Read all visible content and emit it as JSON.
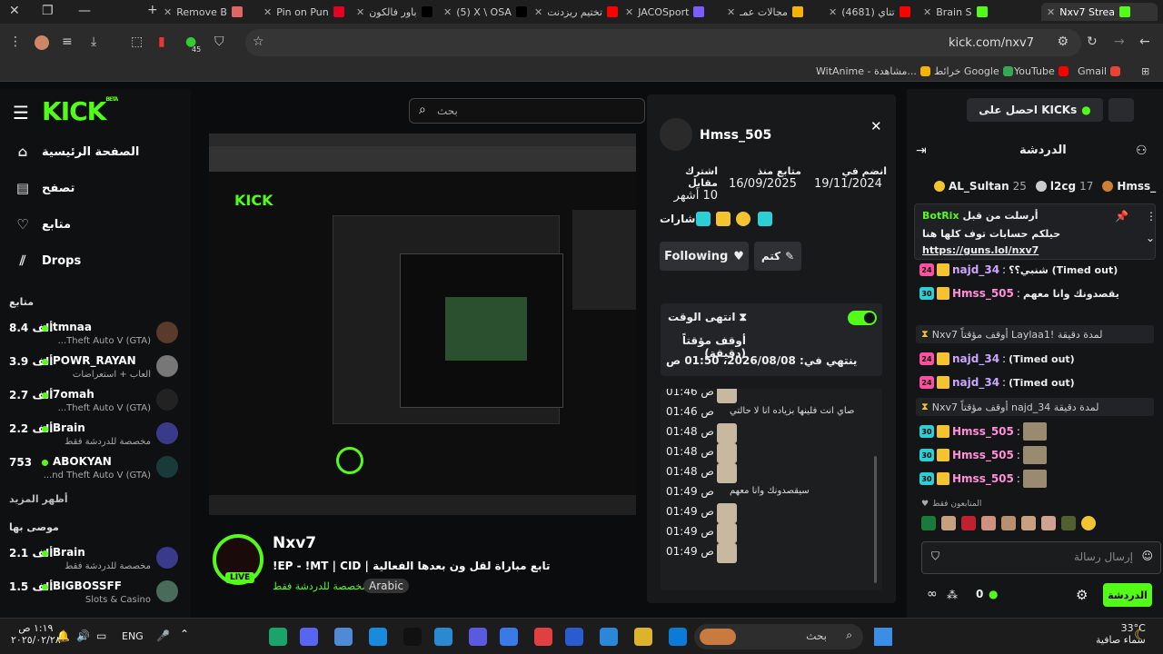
{
  "browser": {
    "tabs": [
      {
        "label": "Remove B",
        "color": "#e06666"
      },
      {
        "label": "Pin on Pun",
        "color": "#e60023"
      },
      {
        "label": "باور فالكون",
        "color": "#000000"
      },
      {
        "label": "(5) X \\ OSA",
        "color": "#000000"
      },
      {
        "label": "تختيم ريزدنت",
        "color": "#ff0000"
      },
      {
        "label": "JACOSport",
        "color": "#7b5cff"
      },
      {
        "label": "مجالات عمـ",
        "color": "#f4b400"
      },
      {
        "label": "(4681) تتاي",
        "color": "#ff0000"
      },
      {
        "label": "Brain S",
        "color": "#53fc18"
      },
      {
        "label": "Nxv7 Strea",
        "color": "#53fc18"
      }
    ],
    "url": "kick.com/nxv7",
    "bookmarks": [
      {
        "label": "Gmail",
        "color": "#ea4335"
      },
      {
        "label": "YouTube",
        "color": "#ff0000"
      },
      {
        "label": "خرائط Google",
        "color": "#34a853"
      },
      {
        "label": "WitAnime - مشاهدة...",
        "color": "#f4b400"
      }
    ],
    "ext_badge": "45"
  },
  "kick": {
    "logo": "KICK",
    "logo_beta": "BETA",
    "search_placeholder": "بحث",
    "nav": [
      {
        "label": "الصفحة الرئيسية",
        "icon": "home-icon"
      },
      {
        "label": "تصفح",
        "icon": "browse-icon"
      },
      {
        "label": "متابع",
        "icon": "heart-icon"
      },
      {
        "label": "Drops",
        "icon": "drops-icon"
      }
    ],
    "following_title": "متابع",
    "following": [
      {
        "name": "tmnaa",
        "count": "8.4 ألف",
        "game": "Theft Auto V (GTA)...",
        "avatar": "#5a3a2a"
      },
      {
        "name": "POWR_RAYAN",
        "count": "3.9 ألف",
        "game": "ألعاب + استعراضات",
        "avatar": "#777"
      },
      {
        "name": "7omah",
        "count": "2.7 ألف",
        "game": "Theft Auto V (GTA)...",
        "avatar": "#222"
      },
      {
        "name": "Brain",
        "count": "2.2 ألف",
        "game": "مخصصة للدردشة فقط",
        "avatar": "#3a3a8a"
      },
      {
        "name": "ABOKYAN",
        "count": "753",
        "game": "nd Theft Auto V (GTA)...",
        "avatar": "#1a3a3a"
      }
    ],
    "show_more": "أظهر المزيد",
    "recommended_title": "موصى بها",
    "recommended": [
      {
        "name": "Brain",
        "count": "2.1 ألف",
        "game": "مخصصة للدردشة فقط",
        "avatar": "#3a3a8a"
      },
      {
        "name": "BIGBOSSFF",
        "count": "1.5 ألف",
        "game": "Slots & Casino",
        "avatar": "#4a6a5a"
      }
    ],
    "stream": {
      "channel": "Nxv7",
      "title": "!EP - !MT | CID | تابع مباراة لقل ون بعدها الفعالية",
      "category": "مخصصة للدردشة فقط",
      "language": "Arabic",
      "live": "LIVE"
    },
    "profile": {
      "username": "Hmss_505",
      "joined_label": "انضم في",
      "joined_value": "19/11/2024",
      "follower_label": "متابع منذ",
      "follower_value": "16/09/2025",
      "sub_label": "اشترك مقابل",
      "sub_value": "10 أشهر",
      "badges_label": "شارات",
      "following_btn": "Following",
      "mute_btn": "كتم",
      "timeout_title": "انتهى الوقت",
      "timeout_sub": "أوقف مؤقتاً (دقيقة)",
      "timeout_ends": "ينتهي في: 2026/08/08، 01:50 ص",
      "messages": [
        {
          "time": "01:46 ص",
          "text": ""
        },
        {
          "time": "01:46 ص",
          "text": "صاي انت فلينها بزياده انا لا حالتي"
        },
        {
          "time": "01:48 ص",
          "text": ""
        },
        {
          "time": "01:48 ص",
          "text": ""
        },
        {
          "time": "01:48 ص",
          "text": ""
        },
        {
          "time": "01:49 ص",
          "text": "سيقصدونك وانا معهم"
        },
        {
          "time": "01:49 ص",
          "text": ""
        },
        {
          "time": "01:49 ص",
          "text": ""
        },
        {
          "time": "01:49 ص",
          "text": ""
        }
      ]
    },
    "chat": {
      "get_kicks": "احصل على KICKs",
      "title": "الدردشة",
      "top_gifters": [
        {
          "name": "AL_Sultan",
          "count": "25",
          "color": "#f4c430"
        },
        {
          "name": "l2cg",
          "count": "17",
          "color": "#ccc"
        },
        {
          "name": "Hmss_",
          "count": "",
          "color": "#cd7f32"
        }
      ],
      "pinned_by": "أرسلت من قبل",
      "pinned_user": "BotRix",
      "pinned_text": "حيلكم حسابات توف كلها هنا",
      "pinned_link": "https://guns.lol/nxv7",
      "lines": [
        {
          "user": "najd_34",
          "sub": "24",
          "sub_color": "#ff4fa3",
          "text": "شنبي؟؟ (Timed out)",
          "user_color": "#cba6ff"
        },
        {
          "user": "Hmss_505",
          "sub": "30",
          "sub_color": "#2ad0d6",
          "text": "يقصدونك وانا معهم",
          "user_color": "#ff8fd8"
        },
        {
          "user": "najd_34",
          "sub": "24",
          "sub_color": "#ff4fa3",
          "text": "(Timed out)",
          "user_color": "#cba6ff"
        },
        {
          "user": "najd_34",
          "sub": "24",
          "sub_color": "#ff4fa3",
          "text": "(Timed out)",
          "user_color": "#cba6ff"
        },
        {
          "user": "Hmss_505",
          "sub": "30",
          "sub_color": "#2ad0d6",
          "text": "",
          "user_color": "#ff8fd8"
        },
        {
          "user": "Hmss_505",
          "sub": "30",
          "sub_color": "#2ad0d6",
          "text": "",
          "user_color": "#ff8fd8"
        },
        {
          "user": "Hmss_505",
          "sub": "30",
          "sub_color": "#2ad0d6",
          "text": "",
          "user_color": "#ff8fd8"
        }
      ],
      "mod_notice_1": "Nxv7 أوقف مؤقتاً Laylaa1! لمدة دقيقة",
      "mod_notice_2": "Nxv7 أوقف مؤقتاً najd_34 لمدة دقيقة",
      "followers_only": "المتابعون فقط",
      "input_placeholder": "إرسال رسالة",
      "send_btn": "الدردشة",
      "kicks_count": "0"
    }
  },
  "taskbar": {
    "time": "١:١٩ ص",
    "date": "٢٠٢٥/٠٢/٢٨",
    "lang": "ENG",
    "search": "بحث",
    "weather_temp": "33°C",
    "weather_desc": "سماء صافية"
  }
}
